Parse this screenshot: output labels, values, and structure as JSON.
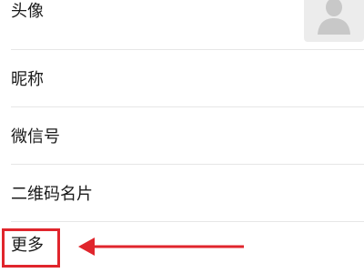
{
  "profile_list": {
    "items": [
      {
        "label": "头像"
      },
      {
        "label": "昵称"
      },
      {
        "label": "微信号"
      },
      {
        "label": "二维码名片"
      },
      {
        "label": "更多"
      }
    ]
  },
  "colors": {
    "annotation": "#e0252c",
    "divider": "#e6e6e6",
    "avatar_bg": "#ececec",
    "avatar_fg": "#c8c8c8"
  },
  "icons": {
    "avatar": "default-user-silhouette-icon",
    "annotation_arrow": "arrow-left-icon"
  }
}
